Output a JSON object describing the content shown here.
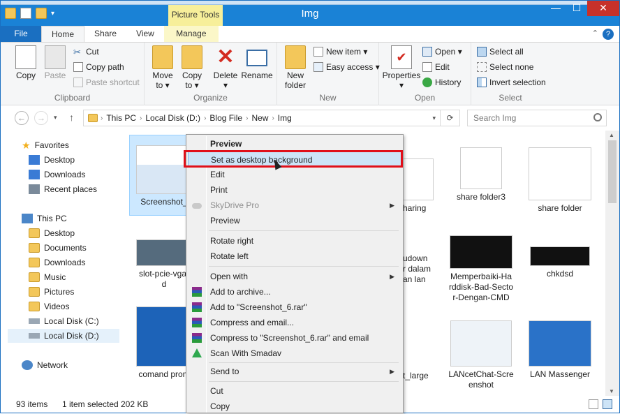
{
  "window": {
    "title": "Img",
    "contextual_tab_group": "Picture Tools",
    "controls": {
      "minimize": "—",
      "maximize": "☐",
      "close": "✕"
    }
  },
  "tabs": [
    {
      "label": "File"
    },
    {
      "label": "Home"
    },
    {
      "label": "Share"
    },
    {
      "label": "View"
    },
    {
      "label": "Manage"
    }
  ],
  "ribbon": {
    "clipboard": {
      "label": "Clipboard",
      "copy": "Copy",
      "paste": "Paste",
      "cut": "Cut",
      "copy_path": "Copy path",
      "paste_shortcut": "Paste shortcut"
    },
    "organize": {
      "label": "Organize",
      "move_to": "Move",
      "move_to_2": "to ▾",
      "copy_to": "Copy",
      "copy_to_2": "to ▾",
      "delete": "Delete",
      "delete_2": "▾",
      "rename": "Rename"
    },
    "new": {
      "label": "New",
      "new_folder": "New",
      "new_folder_2": "folder",
      "new_item": "New item ▾",
      "easy_access": "Easy access ▾"
    },
    "open": {
      "label": "Open",
      "properties": "Properties",
      "properties_2": "▾",
      "open": "Open ▾",
      "edit": "Edit",
      "history": "History"
    },
    "select": {
      "label": "Select",
      "select_all": "Select all",
      "select_none": "Select none",
      "invert": "Invert selection"
    }
  },
  "address": {
    "crumbs": [
      "This PC",
      "Local Disk (D:)",
      "Blog File",
      "New",
      "Img"
    ],
    "search_placeholder": "Search Img"
  },
  "nav": {
    "favorites": "Favorites",
    "fav_items": [
      "Desktop",
      "Downloads",
      "Recent places"
    ],
    "this_pc": "This PC",
    "pc_items": [
      "Desktop",
      "Documents",
      "Downloads",
      "Music",
      "Pictures",
      "Videos",
      "Local Disk (C:)",
      "Local Disk (D:)"
    ],
    "network": "Network"
  },
  "files": {
    "screenshot": "Screenshot_",
    "slot": "slot-pcie-vga-",
    "slot_2": "d",
    "comand": "comand prom",
    "sharing": "haring",
    "share3": "share folder3",
    "share": "share folder",
    "dudown_1": "udown",
    "dudown_2": "r dalam",
    "dudown_3": "an lan",
    "memperbaiki_1": "Memperbaiki-Ha",
    "memperbaiki_2": "rddisk-Bad-Secto",
    "memperbaiki_3": "r-Dengan-CMD",
    "chkdsd": "chkdsd",
    "large": "t_large",
    "lancet_1": "LANcetChat-Scre",
    "lancet_2": "enshot",
    "lanmass": "LAN Massenger"
  },
  "status": {
    "count": "93 items",
    "selected": "1 item selected",
    "size": "202 KB"
  },
  "context_menu": {
    "items": [
      "Preview",
      "Set as desktop background",
      "Edit",
      "Print",
      "SkyDrive Pro",
      "Preview",
      "Rotate right",
      "Rotate left",
      "Open with",
      "Add to archive...",
      "Add to \"Screenshot_6.rar\"",
      "Compress and email...",
      "Compress to \"Screenshot_6.rar\" and email",
      "Scan With Smadav",
      "Send to",
      "Cut",
      "Copy"
    ]
  },
  "colors": {
    "title_bar": "#1a82d6",
    "highlight": "#cde4f7",
    "annotation_red": "#e0101a",
    "picture_tools": "#f7ef9a"
  }
}
